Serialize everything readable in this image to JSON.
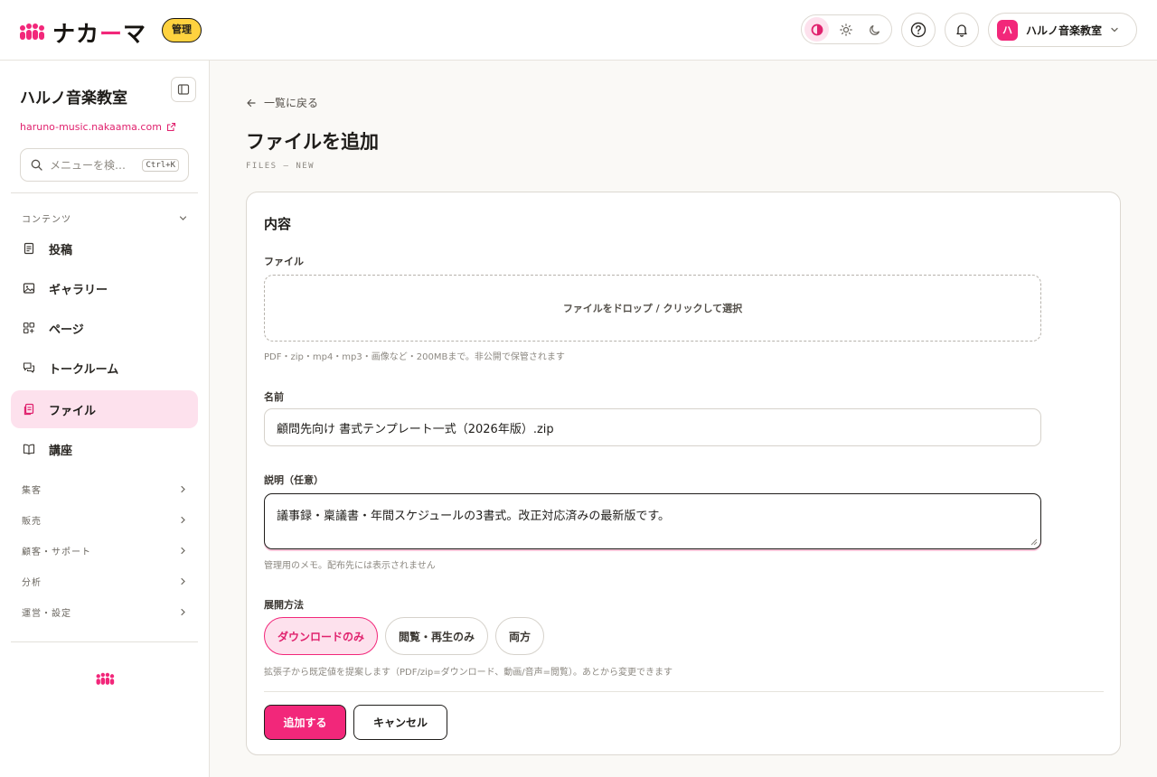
{
  "header": {
    "logo_text_1": "ナカ",
    "logo_text_accent": "ー",
    "logo_text_2": "マ",
    "admin_badge": "管理",
    "theme_icons": [
      "contrast-icon",
      "sun-icon",
      "moon-icon"
    ],
    "help_icon": "question-icon",
    "notifications_icon": "bell-icon",
    "account": {
      "avatar": "ハ",
      "name": "ハルノ音楽教室"
    }
  },
  "sidebar": {
    "org_name": "ハルノ音楽教室",
    "org_url": "haruno-music.nakaama.com",
    "search": {
      "placeholder": "メニューを検…",
      "shortcut": "Ctrl+K"
    },
    "content_section": "コンテンツ",
    "items": [
      {
        "label": "投稿",
        "icon": "document-icon"
      },
      {
        "label": "ギャラリー",
        "icon": "image-icon"
      },
      {
        "label": "ページ",
        "icon": "pages-icon"
      },
      {
        "label": "トークルーム",
        "icon": "chat-icon"
      },
      {
        "label": "ファイル",
        "icon": "file-icon",
        "active": true
      },
      {
        "label": "講座",
        "icon": "book-icon"
      }
    ],
    "sections": [
      "集客",
      "販売",
      "顧客・サポート",
      "分析",
      "運営・設定"
    ]
  },
  "main": {
    "back_link": "一覧に戻る",
    "title": "ファイルを追加",
    "subtitle": "FILES — NEW",
    "card": {
      "title": "内容",
      "file_label": "ファイル",
      "dropzone_text": "ファイルをドロップ / クリックして選択",
      "file_hint": "PDF・zip・mp4・mp3・画像など・200MBまで。非公開で保管されます",
      "name_label": "名前",
      "name_value": "顧問先向け 書式テンプレート一式（2026年版）.zip",
      "desc_label": "説明（任意）",
      "desc_value": "議事録・稟議書・年間スケジュールの3書式。改正対応済みの最新版です。",
      "desc_hint": "管理用のメモ。配布先には表示されません",
      "delivery_label": "展開方法",
      "delivery_options": [
        "ダウンロードのみ",
        "閲覧・再生のみ",
        "両方"
      ],
      "delivery_selected": "ダウンロードのみ",
      "delivery_hint": "拡張子から既定値を提案します（PDF/zip=ダウンロード、動画/音声=閲覧）。あとから変更できます",
      "submit_label": "追加する",
      "cancel_label": "キャンセル"
    }
  },
  "colors": {
    "accent": "#f2277a",
    "accent_soft": "#fde1ed",
    "badge": "#ffd23f"
  }
}
